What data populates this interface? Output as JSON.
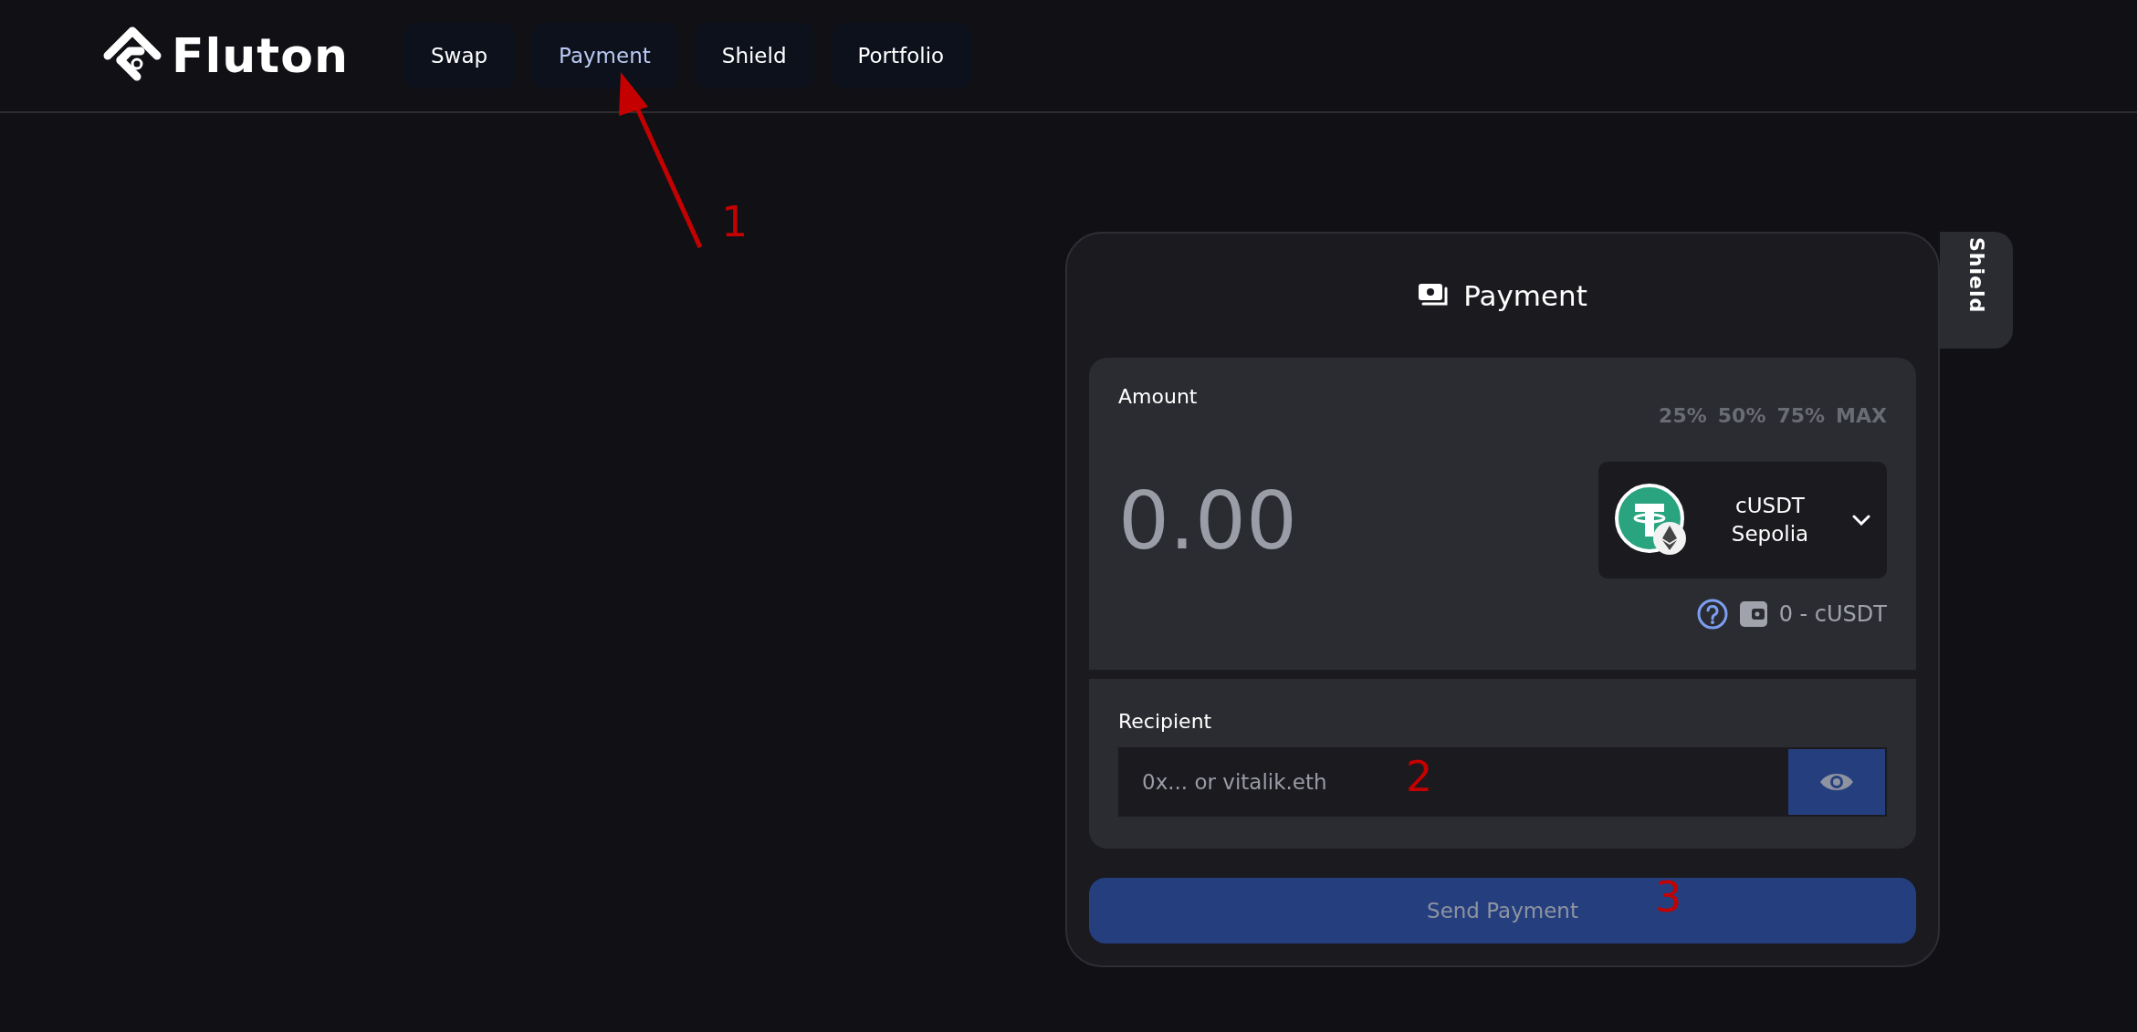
{
  "brand": {
    "name": "Fluton"
  },
  "nav": [
    {
      "label": "Swap",
      "selected": false
    },
    {
      "label": "Payment",
      "selected": true
    },
    {
      "label": "Shield",
      "selected": false
    },
    {
      "label": "Portfolio",
      "selected": false
    }
  ],
  "side_tab": {
    "label": "Shield"
  },
  "card": {
    "title": "Payment",
    "amount": {
      "label": "Amount",
      "placeholder": "0.00",
      "presets": [
        {
          "label": "25%",
          "disabled": true
        },
        {
          "label": "50%",
          "disabled": true
        },
        {
          "label": "75%",
          "disabled": true
        },
        {
          "label": "MAX",
          "disabled": true
        }
      ],
      "token": {
        "symbol": "cUSDT",
        "network": "Sepolia"
      },
      "balance": "0 - cUSDT"
    },
    "recipient": {
      "label": "Recipient",
      "placeholder": "0x... or vitalik.eth"
    },
    "submit": {
      "label": "Send Payment",
      "disabled": true
    }
  },
  "annotations": [
    {
      "label": "1",
      "arrow": true
    },
    {
      "label": "2",
      "arrow": false
    },
    {
      "label": "3",
      "arrow": false
    }
  ]
}
